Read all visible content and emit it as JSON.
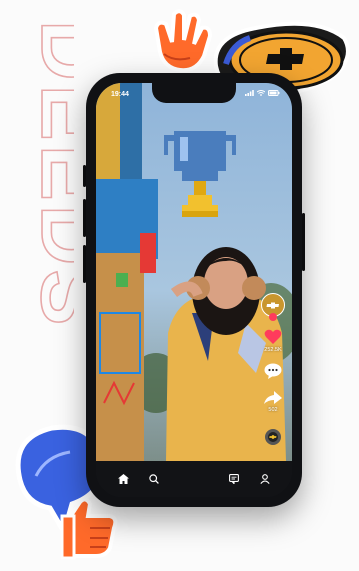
{
  "status_bar": {
    "time": "19:44"
  },
  "background": {
    "word": "DEEDS"
  },
  "sticker": {
    "logo": "chevrolet-bowtie"
  },
  "video": {
    "likes": "252.5K",
    "shares": "502"
  },
  "tabs": [
    {
      "icon": "home-icon"
    },
    {
      "icon": "search-icon"
    },
    {
      "icon": "inbox-icon"
    },
    {
      "icon": "profile-icon"
    }
  ],
  "colors": {
    "like": "#ff3b5c",
    "trophy_blue": "#4a7dbd",
    "trophy_gold": "#f2c12e",
    "jersey": "#e9b44c"
  }
}
